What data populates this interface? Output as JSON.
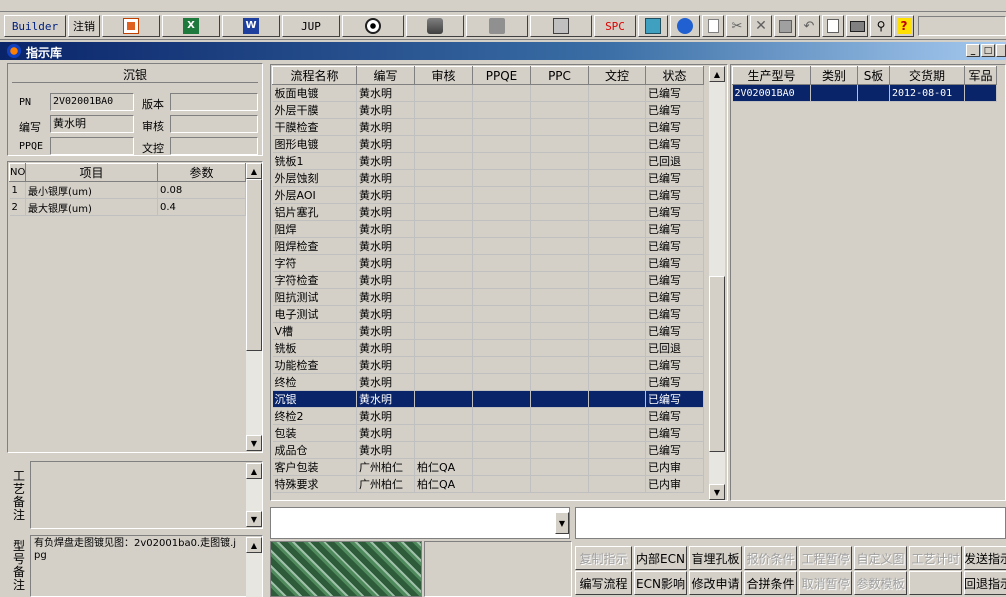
{
  "toolbar": {
    "builder_label": "Builder",
    "logout_label": "注销",
    "jup_label": "JUP",
    "spc_label": "SPC"
  },
  "window": {
    "title": "指示库"
  },
  "left": {
    "header": "沉银",
    "pn_label": "PN",
    "pn_value": "2V02001BA0",
    "version_label": "版本",
    "version_value": "",
    "writer_label": "编写",
    "writer_value": "黄水明",
    "review_label": "审核",
    "review_value": "",
    "ppqe_label": "PPQE",
    "ppqe_value": "",
    "doc_label": "文控",
    "doc_value": "",
    "params": {
      "headers": [
        "NO",
        "项目",
        "参数"
      ],
      "rows": [
        [
          "1",
          "最小银厚(um)",
          "0.08"
        ],
        [
          "2",
          "最大银厚(um)",
          "0.4"
        ]
      ]
    },
    "craft_note_label": "工艺备注",
    "craft_note_text": "",
    "model_note_label": "型号备注",
    "model_note_text": "有负焊盘走图镀见图：2v02001ba0.走图镀.jpg"
  },
  "process": {
    "headers": [
      "流程名称",
      "编写",
      "审核",
      "PPQE",
      "PPC",
      "文控",
      "状态"
    ],
    "rows": [
      [
        "板面电镀",
        "黄水明",
        "",
        "",
        "",
        "",
        "已编写"
      ],
      [
        "外层干膜",
        "黄水明",
        "",
        "",
        "",
        "",
        "已编写"
      ],
      [
        "干膜检查",
        "黄水明",
        "",
        "",
        "",
        "",
        "已编写"
      ],
      [
        "图形电镀",
        "黄水明",
        "",
        "",
        "",
        "",
        "已编写"
      ],
      [
        "铣板1",
        "黄水明",
        "",
        "",
        "",
        "",
        "已回退"
      ],
      [
        "外层蚀刻",
        "黄水明",
        "",
        "",
        "",
        "",
        "已编写"
      ],
      [
        "外层AOI",
        "黄水明",
        "",
        "",
        "",
        "",
        "已编写"
      ],
      [
        "铝片塞孔",
        "黄水明",
        "",
        "",
        "",
        "",
        "已编写"
      ],
      [
        "阻焊",
        "黄水明",
        "",
        "",
        "",
        "",
        "已编写"
      ],
      [
        "阻焊检查",
        "黄水明",
        "",
        "",
        "",
        "",
        "已编写"
      ],
      [
        "字符",
        "黄水明",
        "",
        "",
        "",
        "",
        "已编写"
      ],
      [
        "字符检查",
        "黄水明",
        "",
        "",
        "",
        "",
        "已编写"
      ],
      [
        "阻抗测试",
        "黄水明",
        "",
        "",
        "",
        "",
        "已编写"
      ],
      [
        "电子测试",
        "黄水明",
        "",
        "",
        "",
        "",
        "已编写"
      ],
      [
        "V槽",
        "黄水明",
        "",
        "",
        "",
        "",
        "已编写"
      ],
      [
        "铣板",
        "黄水明",
        "",
        "",
        "",
        "",
        "已回退"
      ],
      [
        "功能检查",
        "黄水明",
        "",
        "",
        "",
        "",
        "已编写"
      ],
      [
        "终检",
        "黄水明",
        "",
        "",
        "",
        "",
        "已编写"
      ],
      [
        "沉银",
        "黄水明",
        "",
        "",
        "",
        "",
        "已编写"
      ],
      [
        "终检2",
        "黄水明",
        "",
        "",
        "",
        "",
        "已编写"
      ],
      [
        "包装",
        "黄水明",
        "",
        "",
        "",
        "",
        "已编写"
      ],
      [
        "成品仓",
        "黄水明",
        "",
        "",
        "",
        "",
        "已编写"
      ],
      [
        "客户包装",
        "广州柏仁",
        "柏仁QA",
        "",
        "",
        "",
        "已内审"
      ],
      [
        "特殊要求",
        "广州柏仁",
        "柏仁QA",
        "",
        "",
        "",
        "已内审"
      ]
    ],
    "selected_index": 18
  },
  "orders": {
    "headers": [
      "生产型号",
      "类别",
      "S板",
      "交货期",
      "军品"
    ],
    "rows": [
      [
        "2V02001BA0",
        "",
        "",
        "2012-08-01",
        ""
      ]
    ]
  },
  "bottom": {
    "combo_value": "",
    "text_value": "",
    "buttons_row1": [
      {
        "label": "复制指示",
        "enabled": false
      },
      {
        "label": "内部ECN",
        "enabled": true
      },
      {
        "label": "盲埋孔板",
        "enabled": true
      },
      {
        "label": "报价条件",
        "enabled": false
      },
      {
        "label": "工程暂停",
        "enabled": false
      },
      {
        "label": "自定义图",
        "enabled": false
      },
      {
        "label": "工艺计时",
        "enabled": false
      },
      {
        "label": "发送指示",
        "enabled": true
      }
    ],
    "buttons_row2": [
      {
        "label": "编写流程",
        "enabled": true
      },
      {
        "label": "ECN影响",
        "enabled": true
      },
      {
        "label": "修改申请",
        "enabled": true
      },
      {
        "label": "合拼条件",
        "enabled": true
      },
      {
        "label": "取消暂停",
        "enabled": false
      },
      {
        "label": "参数模板",
        "enabled": false
      },
      {
        "label": "",
        "enabled": false
      },
      {
        "label": "回退指示",
        "enabled": true
      }
    ]
  },
  "colors": {
    "selection": "#0a246a",
    "face": "#d4d0c8"
  }
}
